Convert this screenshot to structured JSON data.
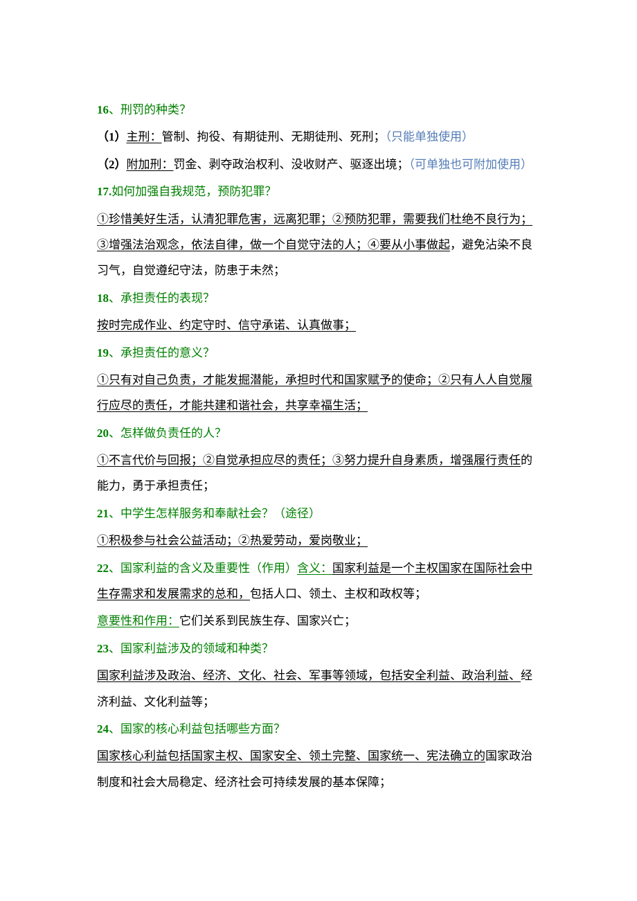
{
  "e16": {
    "num": "16",
    "sep": "、",
    "title": "刑罚的种类？",
    "p1_num": "（1）",
    "p1_label": "主刑：",
    "p1_text": "管制、拘役、有期徒刑、无期徒刑、死刑；",
    "p1_note": "（只能单独使用）",
    "p2_num": "（2）",
    "p2_label": "附加刑：",
    "p2_text": "罚金、剥夺政治权利、没收财产、驱逐出境；",
    "p2_note": "（可单独也可附加使用）"
  },
  "e17": {
    "num": "17.",
    "title": "如何加强自我规范，预防犯罪？",
    "body_u1": "①珍惜美好生活，认清犯罪危害，远离犯罪；②预防犯罪，需要我们杜绝不良行为；③增强法治观念，依法自律，做一个自觉守法的人；④要从小事做起",
    "body_tail": "，避免沾染不良习气，自觉遵纪守法，防患于未然；"
  },
  "e18": {
    "num": "18",
    "sep": "、",
    "title": "承担责任的表现？",
    "body": "按时完成作业、约定守时、信守承诺、认真做事；"
  },
  "e19": {
    "num": "19",
    "sep": "、",
    "title": "承担责任的意义？",
    "body_u": "①只有对自己负责，才能发掘潜能，承担时代和国家赋予的使命；②只有人人自觉履行应尽的责任，才能共建和谐社会，共享幸福生活；"
  },
  "e20": {
    "num": "20",
    "sep": "、",
    "title": "怎样做负责任的人？",
    "body_u": "①不言代价与回报；②自觉承担应尽的责任；③努力提升自身素质，增强履行责任",
    "body_tail": "的能力，勇于承担责任；"
  },
  "e21": {
    "num": "21",
    "sep": "、",
    "title": "中学生怎样服务和奉献社会？（途径）",
    "body": "①积极参与社会公益活动；②热爱劳动，爱岗敬业；"
  },
  "e22": {
    "num": "22",
    "sep": "、",
    "title": "国家利益的含义及重要性（作用）",
    "def_label": "含义：",
    "def_u": "国家利益是一个主权国家在国际社会中生存需求和发展需求的总和，",
    "def_tail": "包括人口、领土、主权和政权等；",
    "imp_label": "意要性和作用：",
    "imp_body": "它们关系到民族生存、国家兴亡；"
  },
  "e23": {
    "num": "23",
    "sep": "、",
    "title": "国家利益涉及的领域和种类？",
    "body_u": "国家利益涉及政治、经济、文化、社会、军事等领域，包括安全利益、政治利益、",
    "body_tail": "经济利益、文化利益等；"
  },
  "e24": {
    "num": "24",
    "sep": "、",
    "title": "国家的核心利益包括哪些方面？",
    "body_u": "国家核心利益包括国家主权、国家安全、领土完整、国家统一、宪法确立的",
    "body_tail": "国家政治制度和社会大局稳定、经济社会可持续发展的基本保障；"
  }
}
